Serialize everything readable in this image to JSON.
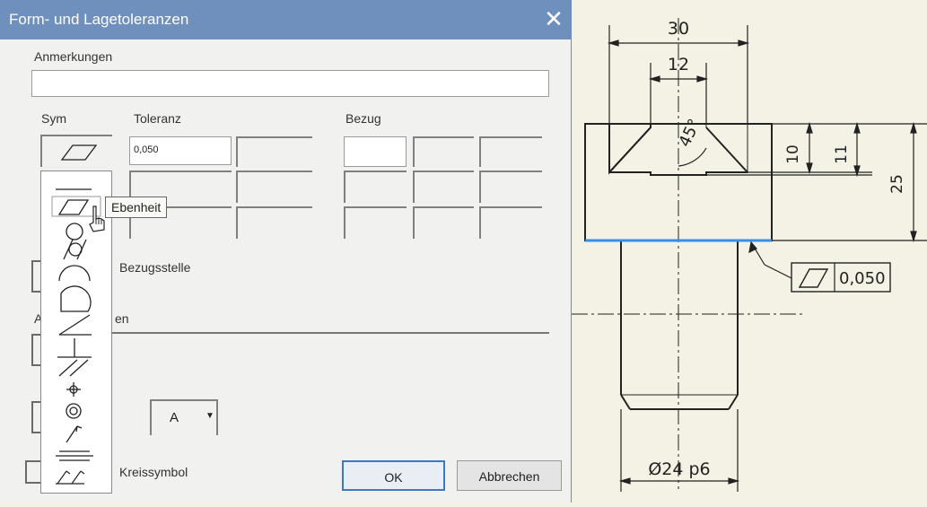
{
  "dialog": {
    "title": "Form- und Lagetoleranzen",
    "close_glyph": "✕",
    "annotations_label": "Anmerkungen",
    "annotations_value": "",
    "sym_header": "Sym",
    "tolerance_header": "Toleranz",
    "datum_header": "Bezug",
    "tolerance_value": "0,050",
    "datum_label_partial": "Bezugsstelle",
    "partial_label_a": "A",
    "partial_label_b": "en",
    "select_value": "A",
    "kreissymbol_label": "Kreissymbol",
    "ok_label": "OK",
    "cancel_label": "Abbrechen"
  },
  "tooltip": {
    "text": "Ebenheit"
  },
  "palette": {
    "items": [
      "straightness-icon",
      "flatness-icon",
      "roundness-icon",
      "cylindricity-icon",
      "line-profile-icon",
      "surface-profile-icon",
      "angularity-icon",
      "perpendicularity-icon",
      "parallelism-icon",
      "position-icon",
      "concentricity-icon",
      "circular-runout-icon",
      "symmetry-icon",
      "total-runout-icon"
    ]
  },
  "drawing": {
    "dim_top": "30",
    "dim_inner": "12",
    "dim_angle": "45°",
    "dim_10": "10",
    "dim_11": "11",
    "dim_25": "25",
    "frame_value": "0,050",
    "dim_diameter": "Ø24 p6",
    "highlight_color": "#3a8ee6"
  }
}
